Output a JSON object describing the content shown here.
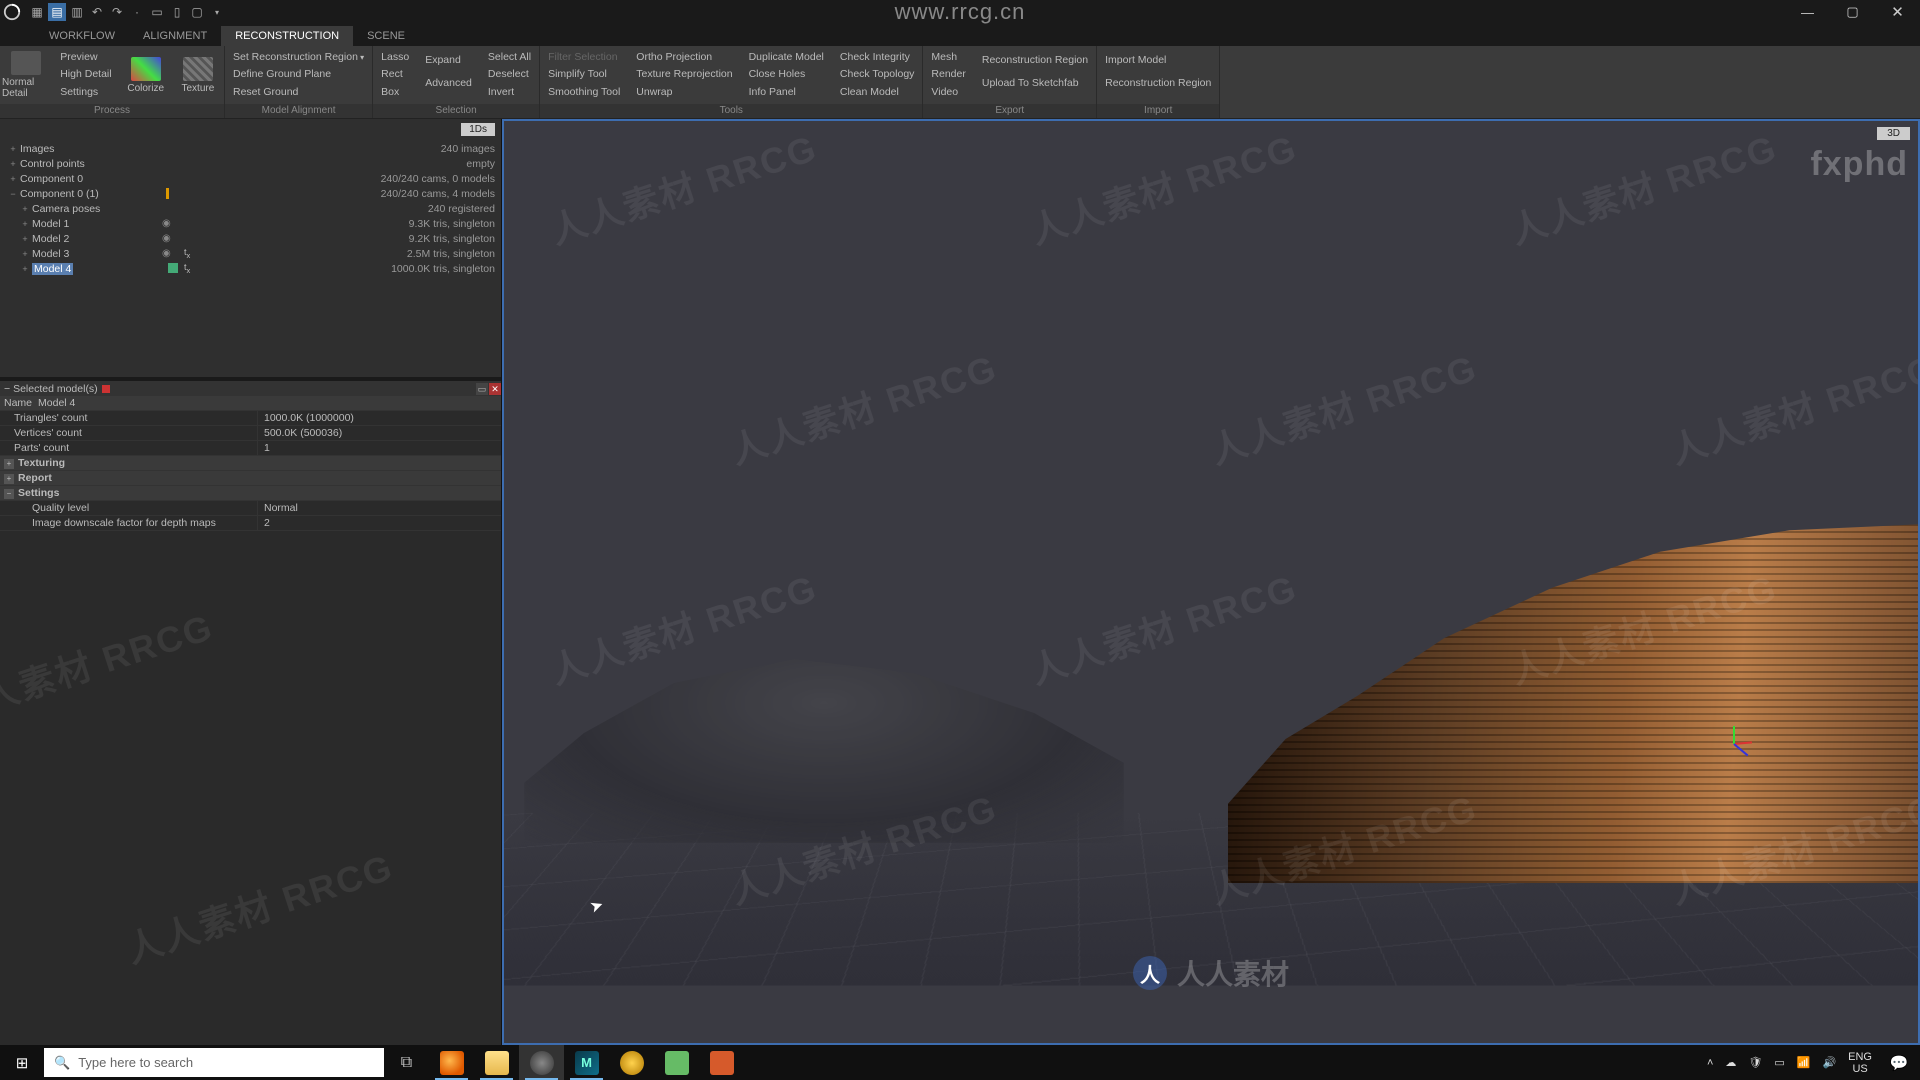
{
  "titlebar": {
    "url_watermark": "www.rrcg.cn"
  },
  "tabs": {
    "workflow": "WORKFLOW",
    "alignment": "ALIGNMENT",
    "reconstruction": "RECONSTRUCTION",
    "scene": "SCENE",
    "active": "reconstruction"
  },
  "ribbon": {
    "process": {
      "label": "Process",
      "normal_detail": "Normal Detail",
      "preview": "Preview",
      "high_detail": "High Detail",
      "settings": "Settings",
      "colorize": "Colorize",
      "texture": "Texture"
    },
    "model_alignment": {
      "label": "Model Alignment",
      "set_region": "Set Reconstruction Region",
      "define_ground": "Define Ground Plane",
      "reset_ground": "Reset Ground"
    },
    "selection": {
      "label": "Selection",
      "lasso": "Lasso",
      "rect": "Rect",
      "box": "Box",
      "expand": "Expand",
      "advanced": "Advanced",
      "select_all": "Select All",
      "deselect": "Deselect",
      "invert": "Invert"
    },
    "tools": {
      "label": "Tools",
      "filter": "Filter Selection",
      "simplify": "Simplify Tool",
      "smoothing": "Smoothing Tool",
      "ortho": "Ortho Projection",
      "tex_reproj": "Texture Reprojection",
      "unwrap": "Unwrap",
      "dup": "Duplicate Model",
      "close_holes": "Close Holes",
      "info": "Info Panel",
      "check_int": "Check Integrity",
      "check_topo": "Check Topology",
      "clean": "Clean Model"
    },
    "export": {
      "label": "Export",
      "mesh": "Mesh",
      "render": "Render",
      "video": "Video",
      "recon_region": "Reconstruction Region",
      "sketchfab": "Upload To Sketchfab"
    },
    "import": {
      "label": "Import",
      "import_model": "Import Model",
      "recon_region": "Reconstruction Region"
    }
  },
  "tree": {
    "tag": "1Ds",
    "images": {
      "label": "Images",
      "value": "240 images"
    },
    "control_points": {
      "label": "Control points",
      "value": "empty"
    },
    "component0": {
      "label": "Component 0",
      "value": "240/240 cams, 0 models"
    },
    "component01": {
      "label": "Component 0 (1)",
      "value": "240/240 cams, 4 models"
    },
    "camera_poses": {
      "label": "Camera poses",
      "value": "240 registered"
    },
    "model1": {
      "label": "Model 1",
      "value": "9.3K tris, singleton"
    },
    "model2": {
      "label": "Model 2",
      "value": "9.2K tris, singleton"
    },
    "model3": {
      "label": "Model 3",
      "value": "2.5M tris, singleton"
    },
    "model4": {
      "label": "Model 4",
      "value": "1000.0K tris, singleton"
    }
  },
  "props": {
    "title": "Selected model(s)",
    "name_k": "Name",
    "name_v": "Model 4",
    "tri_k": "Triangles' count",
    "tri_v": "1000.0K (1000000)",
    "vert_k": "Vertices' count",
    "vert_v": "500.0K (500036)",
    "parts_k": "Parts' count",
    "parts_v": "1",
    "texturing": "Texturing",
    "report": "Report",
    "settings": "Settings",
    "quality_k": "Quality level",
    "quality_v": "Normal",
    "downscale_k": "Image downscale factor for depth maps",
    "downscale_v": "2"
  },
  "viewport": {
    "tag": "3D"
  },
  "watermark": {
    "text": "人人素材  RRCG",
    "footer": "人人素材",
    "fxphd": "fxphd"
  },
  "taskbar": {
    "search_placeholder": "Type here to search",
    "lang1": "ENG",
    "lang2": "US",
    "time": "",
    "icons": [
      "firefox",
      "explorer",
      "realitycapture",
      "maya",
      "app5",
      "app6",
      "app7"
    ]
  }
}
